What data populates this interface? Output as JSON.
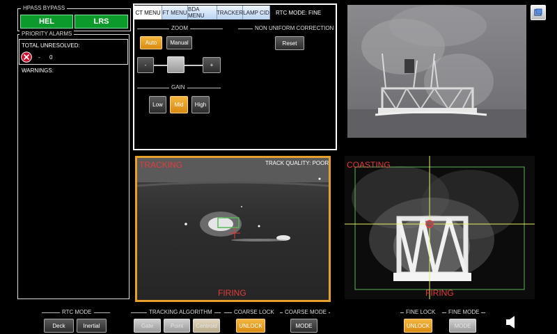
{
  "left_panel": {
    "hpass_title": "HPASS BYPASS",
    "hel_label": "HEL",
    "lrs_label": "LRS",
    "alarms_title": "PRIORITY ALARMS",
    "total_unresolved_label": "TOTAL UNRESOLVED:",
    "count_dash": "-",
    "count_value": "0",
    "warnings_label": "WARNINGS:"
  },
  "menu_panel": {
    "tabs": [
      "CT MENU",
      "FT MENU",
      "BDA MENU",
      "TRACKER",
      "LAMP CID"
    ],
    "rtc_mode_label": "RTC MODE: FINE",
    "zoom_title": "ZOOM",
    "auto_label": "Auto",
    "manual_label": "Manual",
    "minus_label": "-",
    "plus_label": "+",
    "nuc_title": "NON UNIFORM CORRECTION",
    "reset_label": "Reset",
    "gain_title": "GAIN",
    "gain_options": [
      "Low",
      "Mid",
      "High"
    ],
    "gain_selected": "Mid"
  },
  "tracking_view": {
    "status_label": "TRACKING",
    "track_quality": "TRACK QUALITY: POOR",
    "firing_label": "FIRING"
  },
  "fine_view": {
    "status_label": "COASTING",
    "firing_label": "FIRING"
  },
  "bottom_bar": {
    "rtc_mode_title": "RTC MODE",
    "deck_label": "Deck",
    "inertial_label": "Inertial",
    "tracking_algorithm_title": "TRACKING ALGORITHM",
    "algo_buttons": [
      "Gate",
      "Point",
      "Centroid"
    ],
    "coarse_lock_title": "COARSE LOCK",
    "coarse_unlock_label": "UNLOCK",
    "coarse_mode_title": "COARSE MODE",
    "coarse_mode_label": "MODE",
    "fine_lock_title": "FINE LOCK",
    "fine_unlock_label": "UNLOCK",
    "fine_mode_title": "FINE MODE",
    "fine_mode_label": "MODE"
  },
  "colors": {
    "accent_orange": "#f0a830",
    "hel_green": "#0c9a2a",
    "alert_red": "#e43b3b",
    "crosshair_yellow": "#e8f060",
    "reticle_green": "#58b858"
  },
  "icons": [
    "close-circle-icon",
    "window-restore-icon",
    "speaker-icon"
  ]
}
